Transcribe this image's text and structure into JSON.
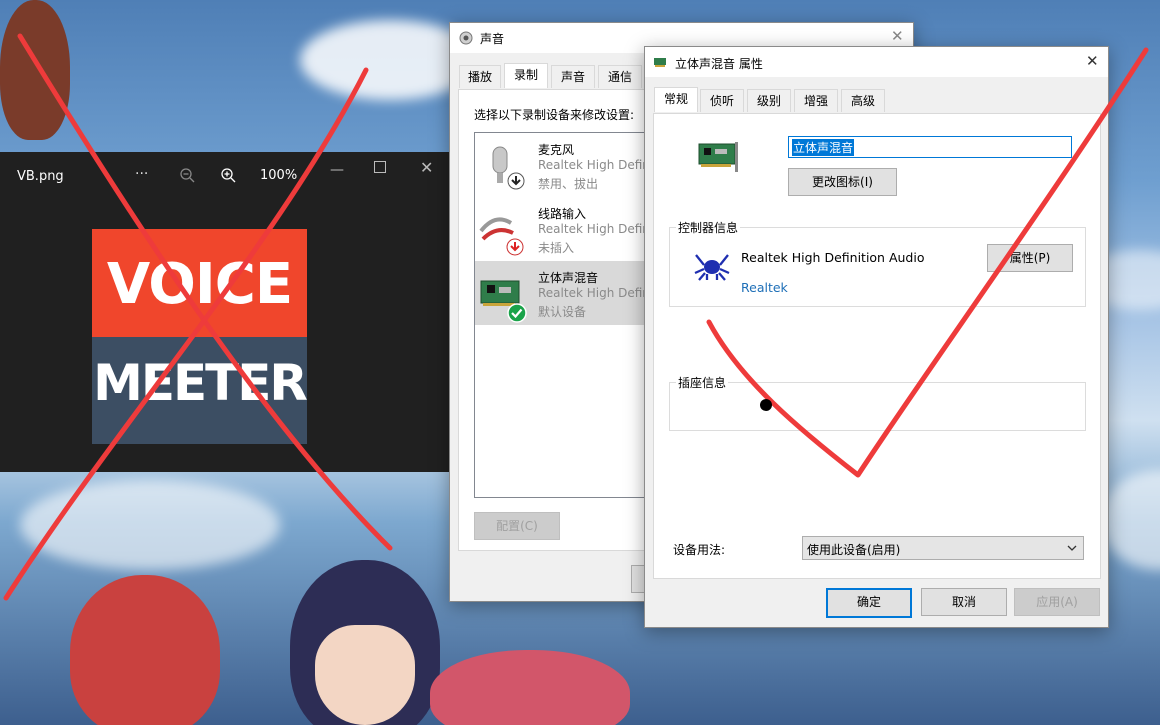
{
  "viewer": {
    "filename": "VB.png",
    "more_icon": "more-icon",
    "zoom_out_icon": "zoom-out-icon",
    "zoom_in_icon": "zoom-in-icon",
    "zoom": "100%",
    "logo_top": "VOICE",
    "logo_bottom": "MEETER"
  },
  "sound": {
    "title": "声音",
    "tabs": [
      "播放",
      "录制",
      "声音",
      "通信"
    ],
    "active_tab": 1,
    "instruction": "选择以下录制设备来修改设置:",
    "devices": [
      {
        "name": "麦克风",
        "driver": "Realtek High Defin",
        "status": "禁用、拔出"
      },
      {
        "name": "线路输入",
        "driver": "Realtek High Defin",
        "status": "未插入"
      },
      {
        "name": "立体声混音",
        "driver": "Realtek High Defin",
        "status": "默认设备"
      }
    ],
    "configure_label": "配置(C)"
  },
  "props": {
    "title": "立体声混音 属性",
    "tabs": [
      "常规",
      "侦听",
      "级别",
      "增强",
      "高级"
    ],
    "active_tab": 0,
    "device_name": "立体声混音",
    "change_icon_label": "更改图标(I)",
    "controller_group": "控制器信息",
    "controller_name": "Realtek High Definition Audio",
    "controller_vendor": "Realtek",
    "properties_label": "属性(P)",
    "jack_group": "插座信息",
    "usage_label": "设备用法:",
    "usage_value": "使用此设备(启用)",
    "ok_label": "确定",
    "cancel_label": "取消",
    "apply_label": "应用(A)"
  },
  "colors": {
    "annotation_red": "#ee3b3b",
    "selection_blue": "#0078d7",
    "voice_red": "#f0462c",
    "meeter_slate": "#3c4e63"
  }
}
